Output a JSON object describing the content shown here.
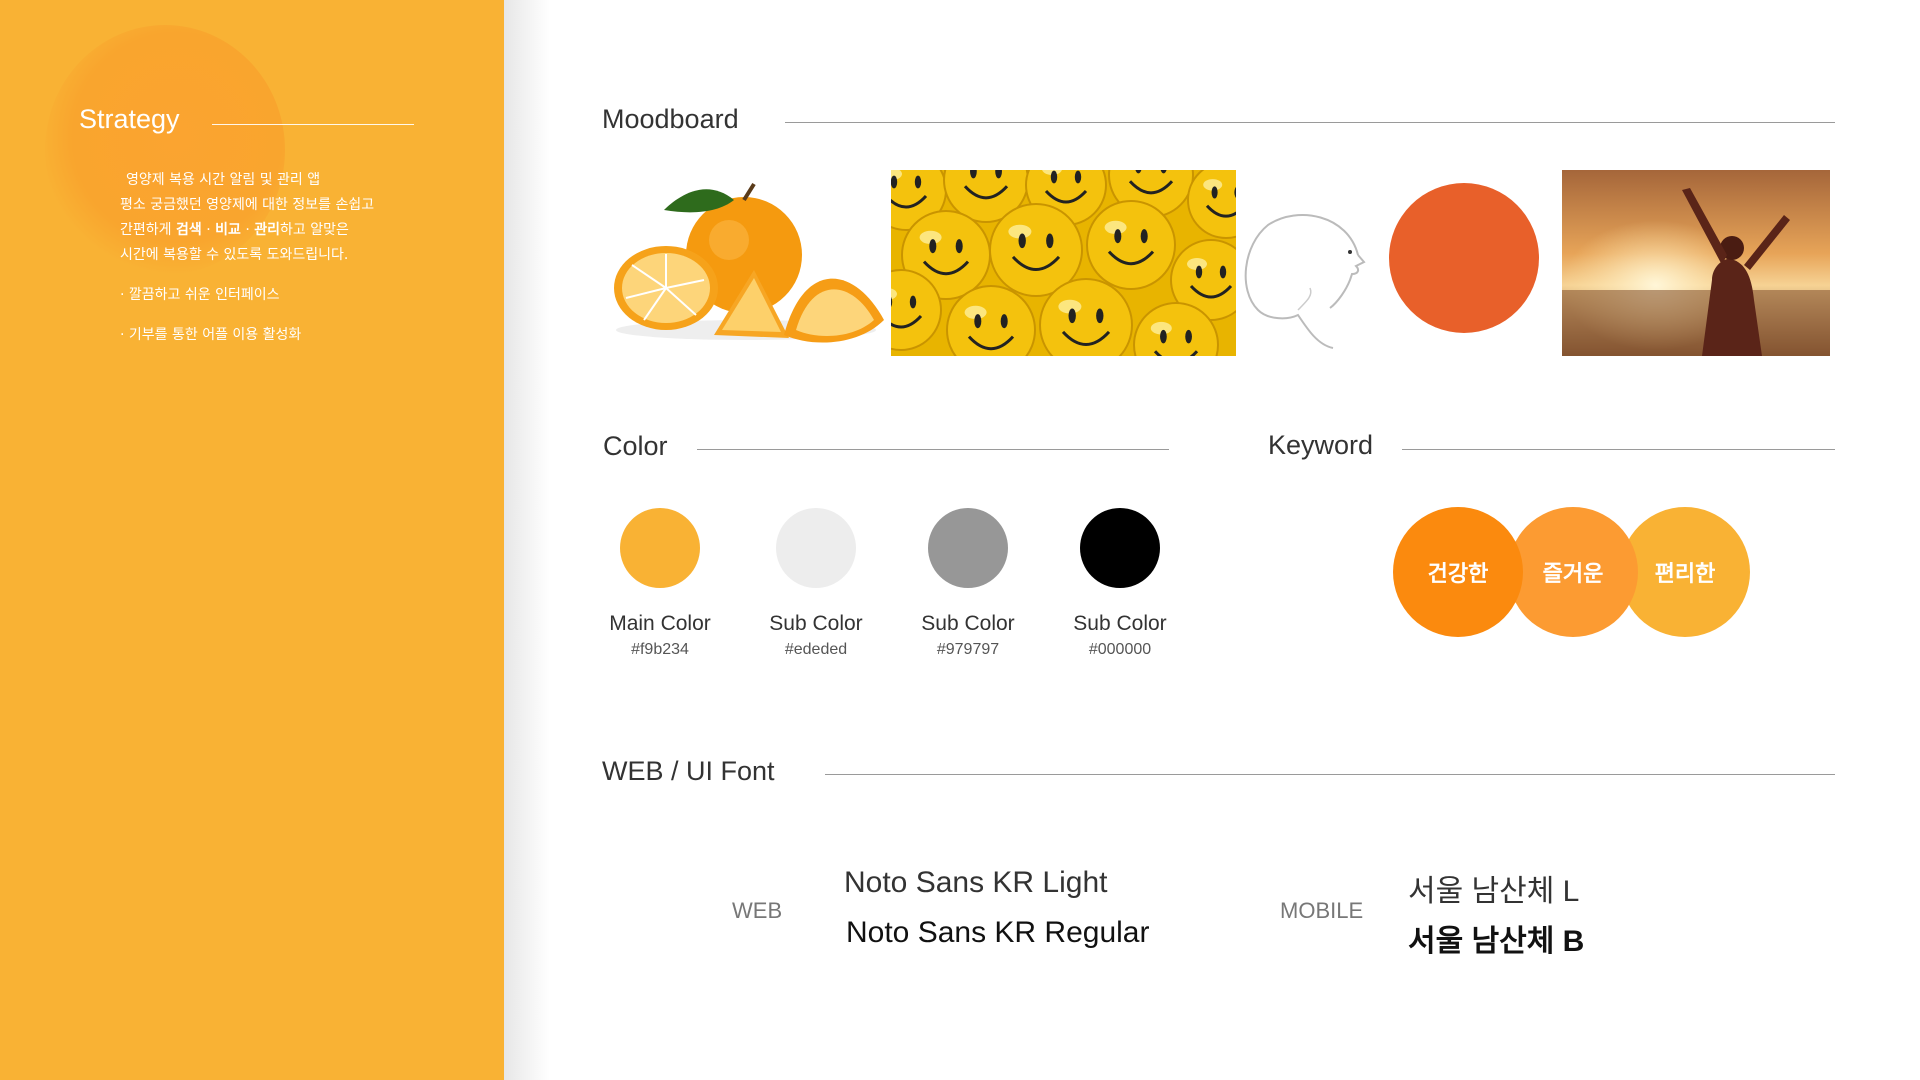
{
  "strategy": {
    "title": "Strategy",
    "lines": [
      "영양제 복용 시간 알림 및 관리 앱",
      "평소 궁금했던 영양제에 대한 정보를 손쉽고"
    ],
    "line3_prefix": "간편하게 ",
    "line3_search": "검색",
    "line3_sep1": " · ",
    "line3_compare": "비교",
    "line3_sep2": " · ",
    "line3_manage": "관리",
    "line3_suffix": "하고 알맞은",
    "line4": "시간에 복용할 수 있도록 도와드립니다.",
    "bullets": [
      "· 깔끔하고 쉬운 인터페이스",
      "· 기부를 통한 어플 이용 활성화"
    ]
  },
  "moodboard": {
    "title": "Moodboard",
    "images": [
      "orange-image",
      "smiley-balls-image",
      "face-blowing-bubble-image",
      "sunset-beach-person-image"
    ]
  },
  "color": {
    "title": "Color",
    "swatches": [
      {
        "label": "Main Color",
        "hex": "#f9b234",
        "fill": "#f9b234"
      },
      {
        "label": "Sub Color",
        "hex": "#ededed",
        "fill": "#ededed"
      },
      {
        "label": "Sub Color",
        "hex": "#979797",
        "fill": "#979797"
      },
      {
        "label": "Sub Color",
        "hex": "#000000",
        "fill": "#000000"
      }
    ]
  },
  "keyword": {
    "title": "Keyword",
    "items": [
      {
        "label": "건강한",
        "color": "#fb8a0e"
      },
      {
        "label": "즐거운",
        "color": "#fc9b32"
      },
      {
        "label": "편리한",
        "color": "#f9b234"
      }
    ]
  },
  "fonts": {
    "title": "WEB / UI Font",
    "web": {
      "category": "WEB",
      "light": "Noto Sans KR Light",
      "regular": "Noto Sans KR Regular"
    },
    "mobile": {
      "category": "MOBILE",
      "light": "서울 남산체 L",
      "regular": "서울 남산체 B"
    }
  }
}
